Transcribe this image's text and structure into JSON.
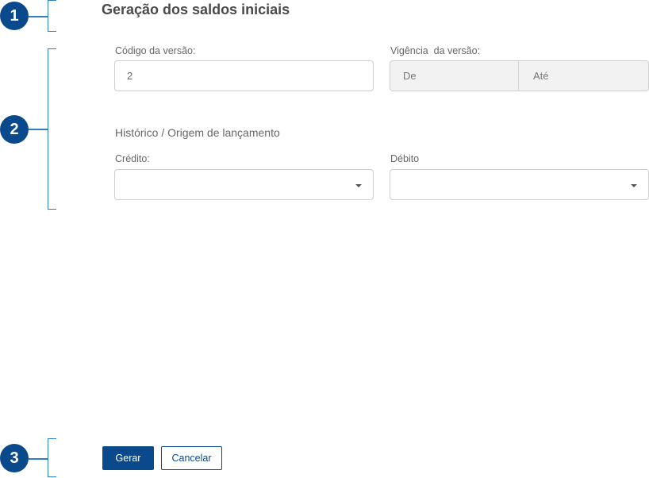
{
  "annotations": [
    "1",
    "2",
    "3"
  ],
  "page": {
    "title": "Geração dos saldos iniciais"
  },
  "form": {
    "version_code_label": "Código da versão:",
    "version_code_value": "2",
    "validity_label": "Vigência  da versão:",
    "validity_from_placeholder": "De",
    "validity_to_placeholder": "Até",
    "history_section_title": "Histórico / Origem de lançamento",
    "credit_label": "Crédito:",
    "credit_value": "",
    "debit_label": "Débito",
    "debit_value": ""
  },
  "actions": {
    "generate_label": "Gerar",
    "cancel_label": "Cancelar"
  },
  "colors": {
    "accent": "#0a4a8c",
    "bracket": "#2f7fc4"
  },
  "icons": {
    "select_caret": "caret-down-icon"
  }
}
